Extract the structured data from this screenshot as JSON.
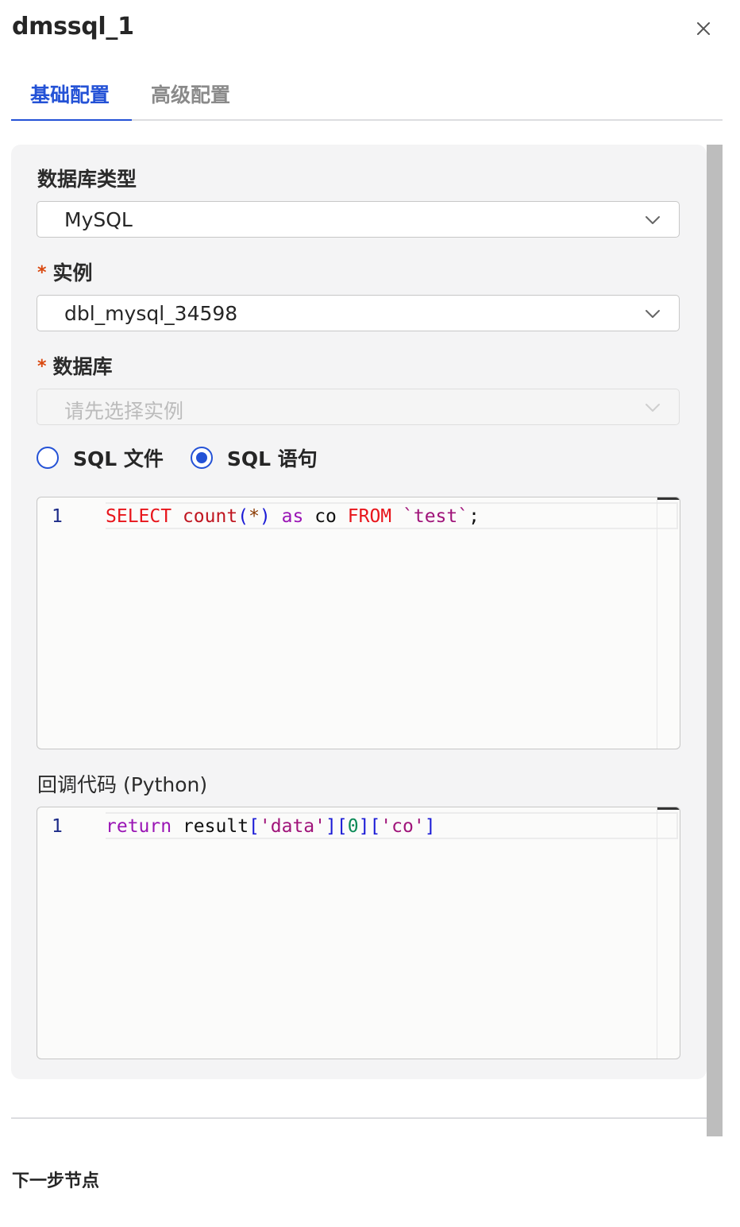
{
  "header": {
    "title": "dmssql_1",
    "close_icon": "close-icon"
  },
  "tabs": [
    {
      "label": "基础配置",
      "active": true
    },
    {
      "label": "高级配置",
      "active": false
    }
  ],
  "form": {
    "db_type": {
      "label": "数据库类型",
      "value": "MySQL"
    },
    "instance": {
      "required_mark": "*",
      "label": "实例",
      "value": "dbl_mysql_34598"
    },
    "database": {
      "required_mark": "*",
      "label": "数据库",
      "placeholder": "请先选择实例",
      "disabled": true
    },
    "source": {
      "options": [
        {
          "label": "SQL 文件",
          "selected": false
        },
        {
          "label": "SQL 语句",
          "selected": true
        }
      ]
    },
    "sql_editor": {
      "line_numbers": [
        "1"
      ],
      "tokens": {
        "select": "SELECT",
        "count": "count",
        "lparen": "(",
        "star": "*",
        "rparen": ")",
        "as": "as",
        "alias": "co",
        "from": "FROM",
        "table": "`test`",
        "semi": ";"
      }
    },
    "callback": {
      "label": "回调代码 (Python)",
      "line_numbers": [
        "1"
      ],
      "tokens": {
        "ret": "return",
        "var": "result",
        "b1o": "[",
        "k1": "'data'",
        "b1c": "]",
        "b2o": "[",
        "idx": "0",
        "b2c": "]",
        "b3o": "[",
        "k2": "'co'",
        "b3c": "]"
      }
    }
  },
  "footer": {
    "next_label": "下一步节点"
  },
  "colors": {
    "accent": "#2452d6",
    "required": "#d9480f"
  }
}
